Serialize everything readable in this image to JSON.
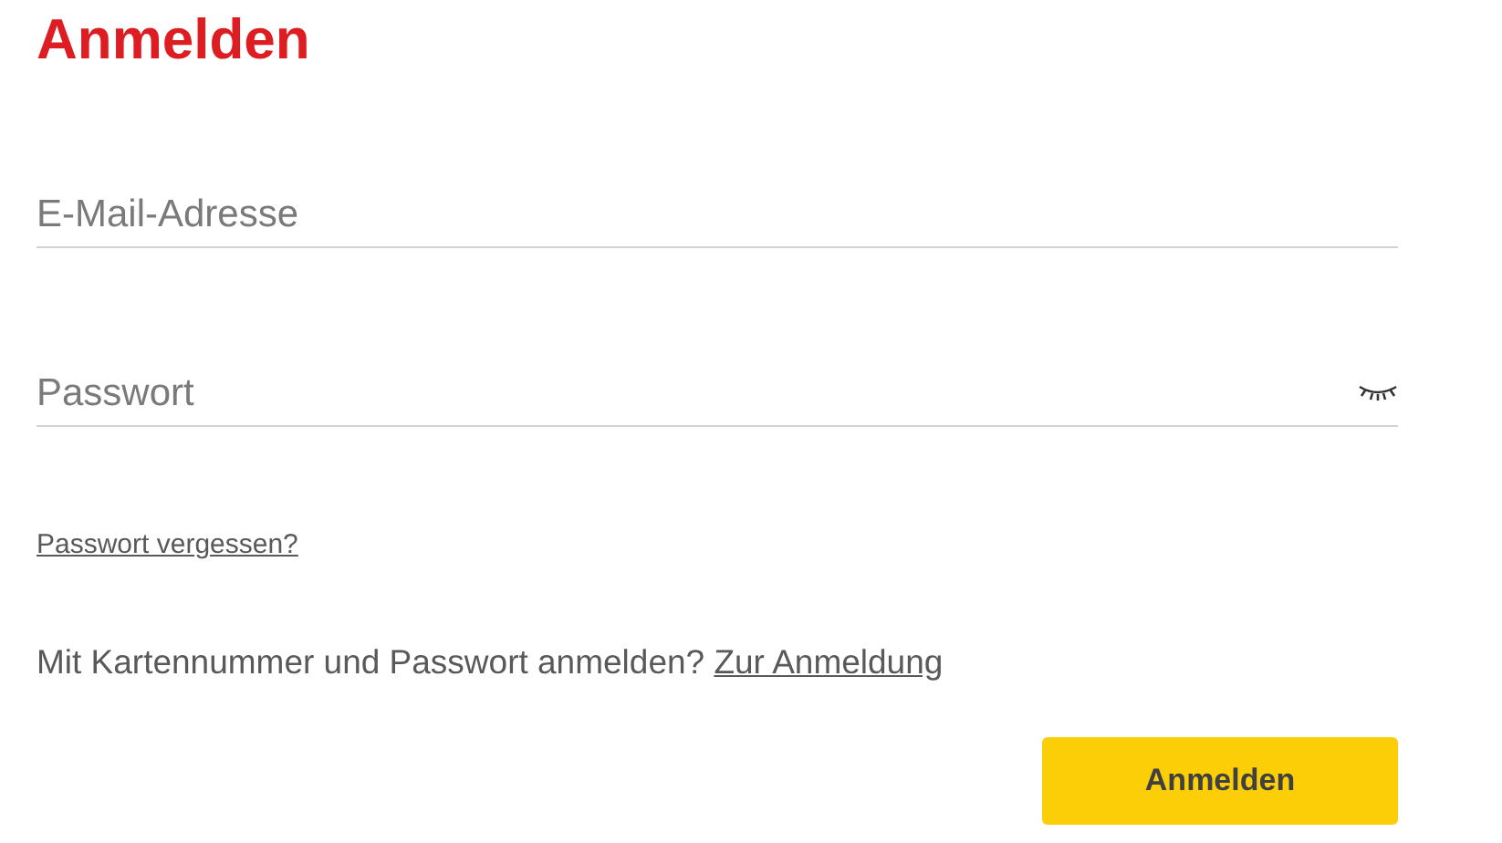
{
  "title": "Anmelden",
  "fields": [
    {
      "kind": "email",
      "placeholder": "E-Mail-Adresse"
    },
    {
      "kind": "password",
      "placeholder": "Passwort",
      "masked": true
    }
  ],
  "forgot_link": "Passwort vergessen?",
  "card_login": {
    "prompt": "Mit Kartennummer und Passwort anmelden?",
    "link": "Zur Anmeldung"
  },
  "submit_button": "Anmelden"
}
